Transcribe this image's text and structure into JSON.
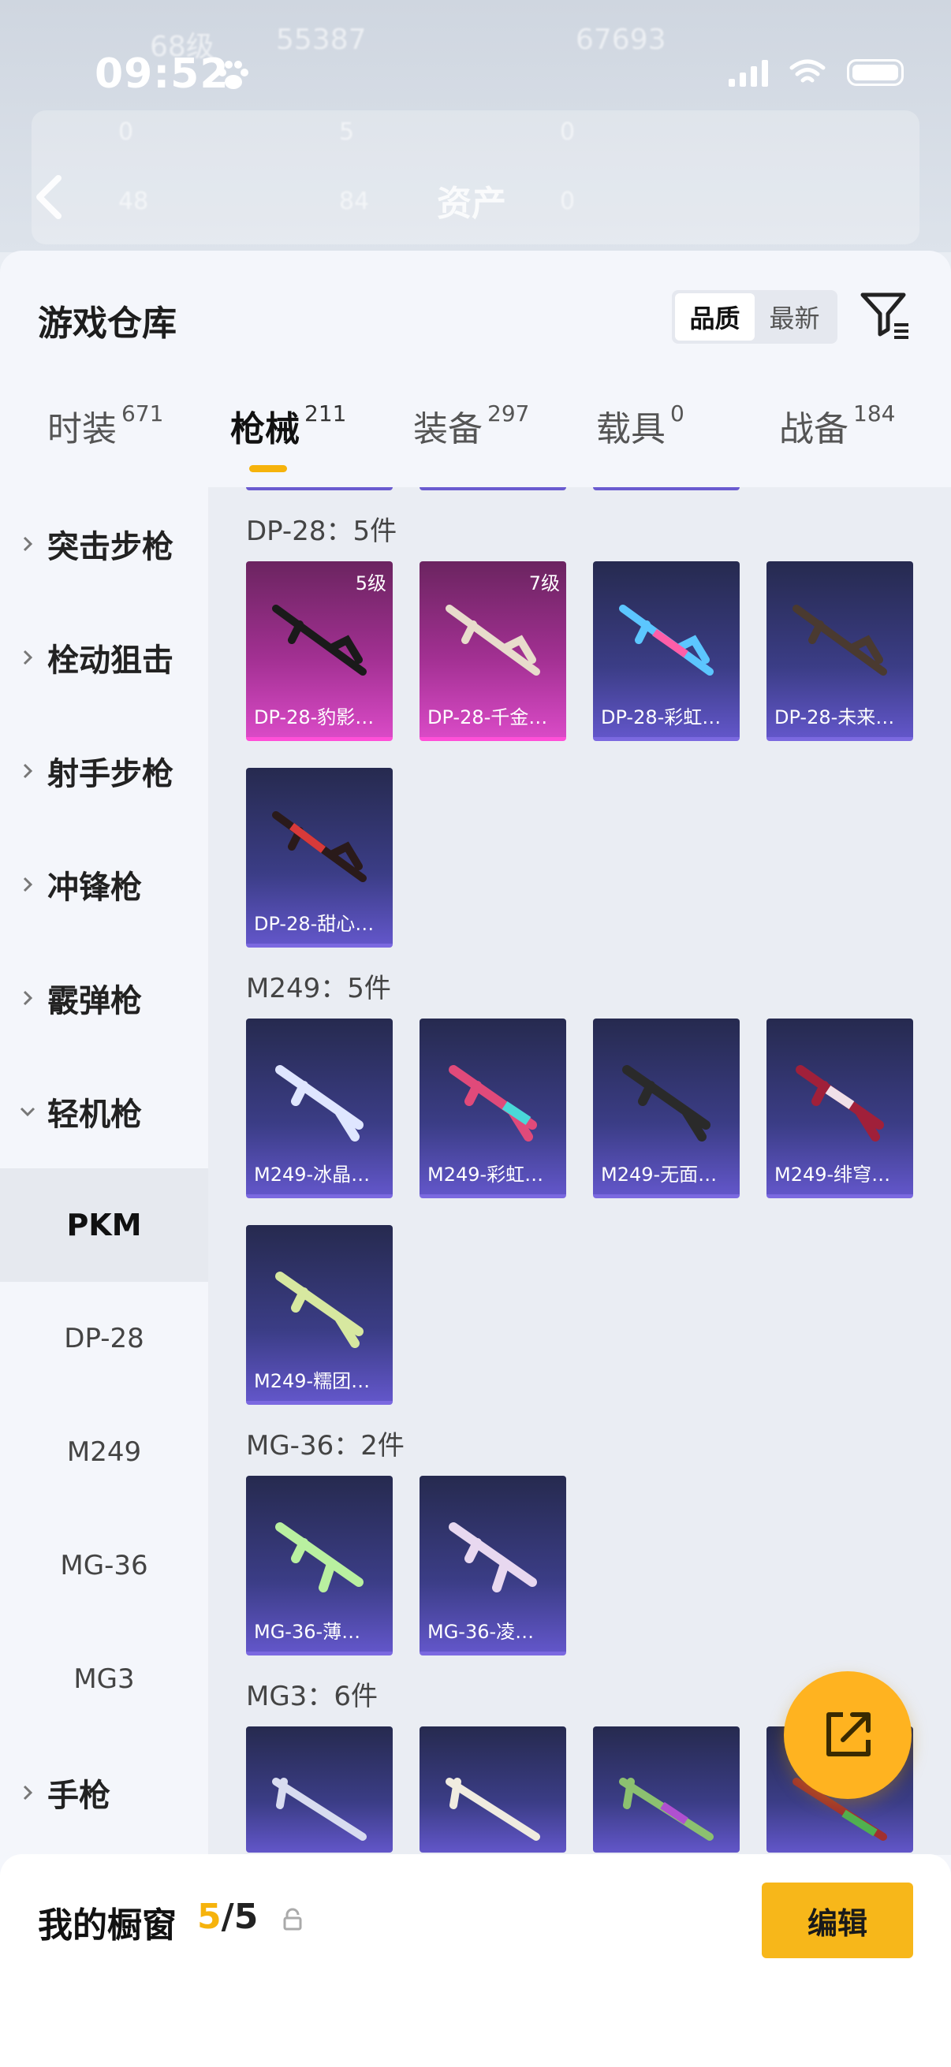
{
  "status_bar": {
    "time": "09:52"
  },
  "background": {
    "title": "资产",
    "stats": [
      "68级",
      "55387",
      "67693",
      "0",
      "5",
      "0",
      "48",
      "84",
      "0"
    ]
  },
  "sheet": {
    "title": "游戏仓库",
    "sort": {
      "quality": "品质",
      "newest": "最新",
      "active": "quality"
    }
  },
  "tabs": [
    {
      "label": "时装",
      "count": "671"
    },
    {
      "label": "枪械",
      "count": "211"
    },
    {
      "label": "装备",
      "count": "297"
    },
    {
      "label": "载具",
      "count": "0"
    },
    {
      "label": "战备",
      "count": "184"
    }
  ],
  "categories": [
    {
      "label": "突击步枪"
    },
    {
      "label": "栓动狙击"
    },
    {
      "label": "射手步枪"
    },
    {
      "label": "冲锋枪"
    },
    {
      "label": "霰弹枪"
    },
    {
      "label": "轻机枪"
    }
  ],
  "subcategories": [
    "PKM",
    "DP-28",
    "M249",
    "MG-36",
    "MG3"
  ],
  "last_category": {
    "label": "手枪"
  },
  "groups": [
    {
      "title": "DP-28：5件",
      "items": [
        {
          "name": "DP-28-豹影…",
          "level": "5级"
        },
        {
          "name": "DP-28-千金…",
          "level": "7级"
        },
        {
          "name": "DP-28-彩虹…",
          "level": ""
        },
        {
          "name": "DP-28-未来…",
          "level": ""
        },
        {
          "name": "DP-28-甜心…",
          "level": ""
        }
      ]
    },
    {
      "title": "M249：5件",
      "items": [
        {
          "name": "M249-冰晶…"
        },
        {
          "name": "M249-彩虹…"
        },
        {
          "name": "M249-无面…"
        },
        {
          "name": "M249-绯穹…"
        },
        {
          "name": "M249-糯团…"
        }
      ]
    },
    {
      "title": "MG-36：2件",
      "items": [
        {
          "name": "MG-36-薄…"
        },
        {
          "name": "MG-36-凌…"
        }
      ]
    },
    {
      "title": "MG3：6件"
    }
  ],
  "bottom": {
    "label": "我的橱窗",
    "current": "5",
    "separator": "/",
    "total": "5",
    "edit": "编辑"
  }
}
